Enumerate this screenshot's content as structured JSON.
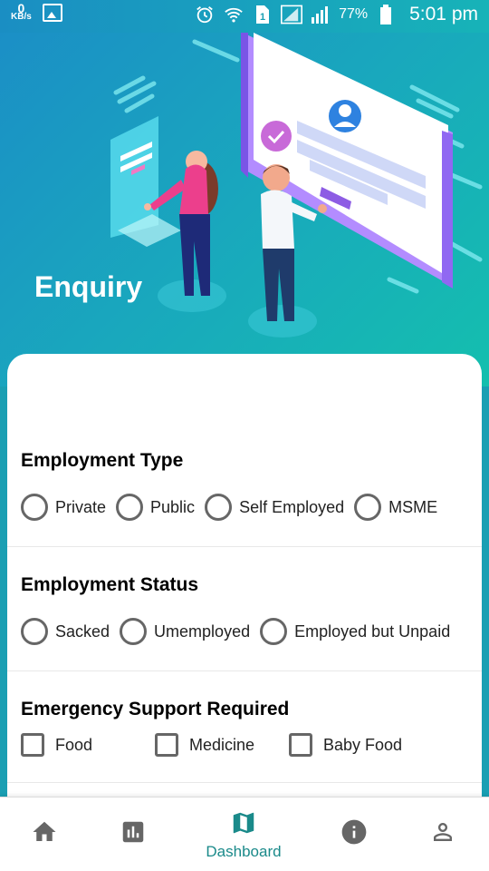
{
  "status_bar": {
    "kbs_value": "0",
    "kbs_unit": "KB/s",
    "battery": "77%",
    "time": "5:01 pm",
    "icons": [
      "alarm-icon",
      "wifi-icon",
      "sim-icon",
      "signal-icon",
      "signal-icon",
      "battery-icon"
    ]
  },
  "hero": {
    "title": "Enquiry"
  },
  "form": {
    "employment_type": {
      "title": "Employment Type",
      "options": [
        "Private",
        "Public",
        "Self Employed",
        "MSME"
      ]
    },
    "employment_status": {
      "title": "Employment Status",
      "options": [
        "Sacked",
        "Umemployed",
        "Employed but Unpaid"
      ]
    },
    "emergency_support": {
      "title": "Emergency Support Required",
      "options": [
        "Food",
        "Medicine",
        "Baby Food"
      ]
    }
  },
  "bottom_nav": {
    "items": [
      {
        "icon": "home-icon",
        "label": ""
      },
      {
        "icon": "bar-chart-icon",
        "label": ""
      },
      {
        "icon": "map-icon",
        "label": "Dashboard"
      },
      {
        "icon": "info-icon",
        "label": ""
      },
      {
        "icon": "person-icon",
        "label": ""
      }
    ],
    "active_color": "#1a8a8a",
    "inactive_color": "#666666"
  }
}
